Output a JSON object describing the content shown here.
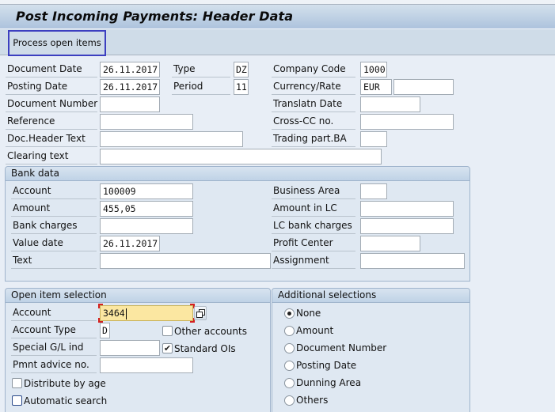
{
  "window": {
    "title": "Post Incoming Payments: Header Data"
  },
  "toolbar": {
    "process_open_items_label": "Process open items"
  },
  "header": {
    "document_date": {
      "label": "Document Date",
      "value": "26.11.2017"
    },
    "type": {
      "label": "Type",
      "value": "DZ"
    },
    "company_code": {
      "label": "Company Code",
      "value": "1000"
    },
    "posting_date": {
      "label": "Posting Date",
      "value": "26.11.2017"
    },
    "period": {
      "label": "Period",
      "value": "11"
    },
    "currency_rate": {
      "label": "Currency/Rate",
      "currency": "EUR",
      "rate": ""
    },
    "document_number": {
      "label": "Document Number",
      "value": ""
    },
    "translatn_date": {
      "label": "Translatn Date",
      "value": ""
    },
    "reference": {
      "label": "Reference",
      "value": ""
    },
    "cross_cc_no": {
      "label": "Cross-CC no.",
      "value": ""
    },
    "doc_header_text": {
      "label": "Doc.Header Text",
      "value": ""
    },
    "trading_part_ba": {
      "label": "Trading part.BA",
      "value": ""
    },
    "clearing_text": {
      "label": "Clearing text",
      "value": ""
    }
  },
  "bank_data": {
    "title": "Bank data",
    "account": {
      "label": "Account",
      "value": "100009"
    },
    "business_area": {
      "label": "Business Area",
      "value": ""
    },
    "amount": {
      "label": "Amount",
      "value": "455,05"
    },
    "amount_in_lc": {
      "label": "Amount in LC",
      "value": ""
    },
    "bank_charges": {
      "label": "Bank charges",
      "value": ""
    },
    "lc_bank_charges": {
      "label": "LC bank charges",
      "value": ""
    },
    "value_date": {
      "label": "Value date",
      "value": "26.11.2017"
    },
    "profit_center": {
      "label": "Profit Center",
      "value": ""
    },
    "text": {
      "label": "Text",
      "value": ""
    },
    "assignment": {
      "label": "Assignment",
      "value": ""
    }
  },
  "open_item_selection": {
    "title": "Open item selection",
    "account": {
      "label": "Account",
      "value": "3464"
    },
    "account_type": {
      "label": "Account Type",
      "value": "D"
    },
    "other_accounts": {
      "label": "Other accounts",
      "checked": false
    },
    "special_gl_ind": {
      "label": "Special G/L ind",
      "value": ""
    },
    "standard_ois": {
      "label": "Standard OIs",
      "checked": true,
      "mark": "✔"
    },
    "pmnt_advice_no": {
      "label": "Pmnt advice no.",
      "value": ""
    },
    "distribute_by_age": {
      "label": "Distribute by age",
      "checked": false
    },
    "automatic_search": {
      "label": "Automatic search",
      "checked": false
    }
  },
  "additional_selections": {
    "title": "Additional selections",
    "selected": "None",
    "options": [
      "None",
      "Amount",
      "Document Number",
      "Posting Date",
      "Dunning Area",
      "Others"
    ]
  }
}
